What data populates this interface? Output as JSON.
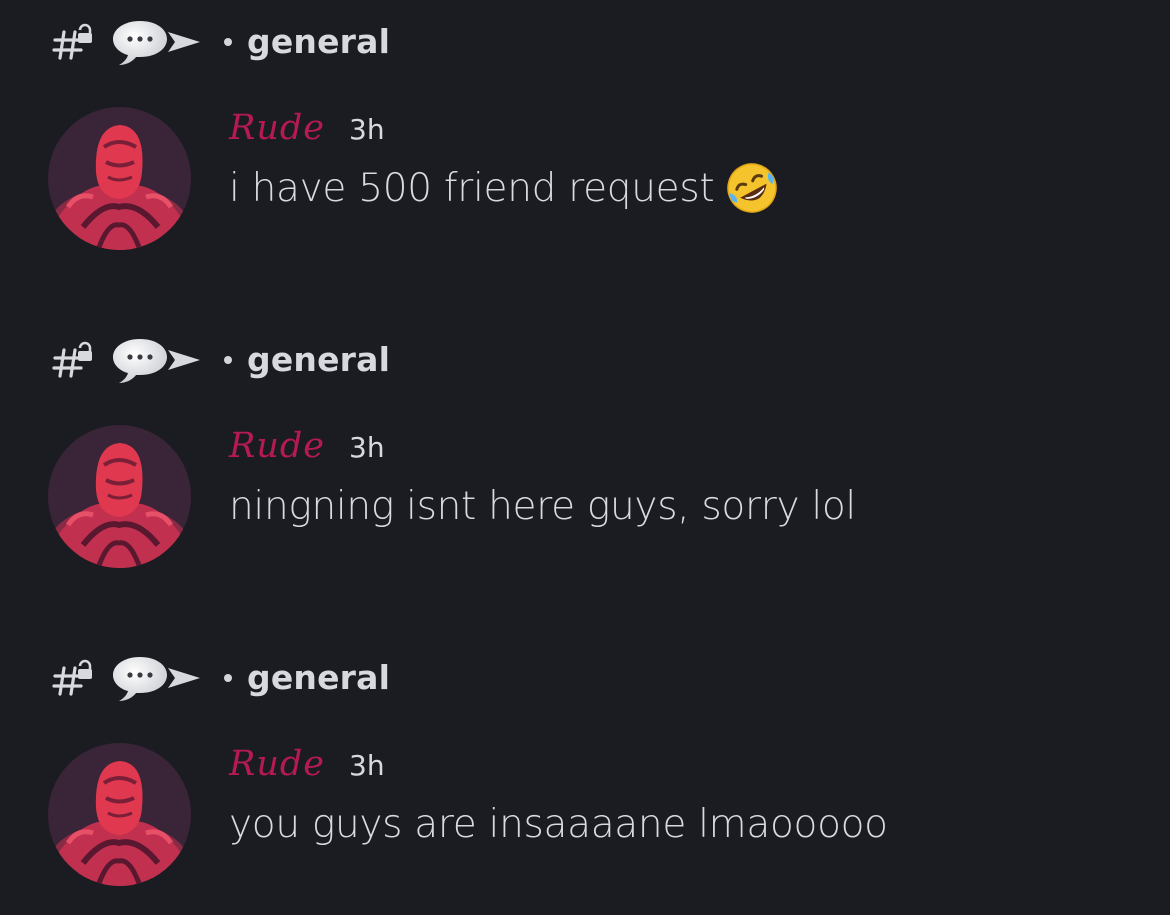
{
  "colors": {
    "background": "#1b1c21",
    "username": "#b51a52",
    "text": "#d8dadf"
  },
  "icons": {
    "channel": "locked-hash-icon",
    "bubble": "speech-bubble-icon",
    "arrow": "arrow-right-icon",
    "emoji": "rolling-on-floor-laughing-emoji"
  },
  "notifications": [
    {
      "channel": "general",
      "username": "Rude",
      "timestamp": "3h",
      "message": "i have 500 friend request"
    },
    {
      "channel": "general",
      "username": "Rude",
      "timestamp": "3h",
      "message": "ningning isnt here guys, sorry lol"
    },
    {
      "channel": "general",
      "username": "Rude",
      "timestamp": "3h",
      "message": "you guys are insaaaane lmaooooo"
    }
  ]
}
